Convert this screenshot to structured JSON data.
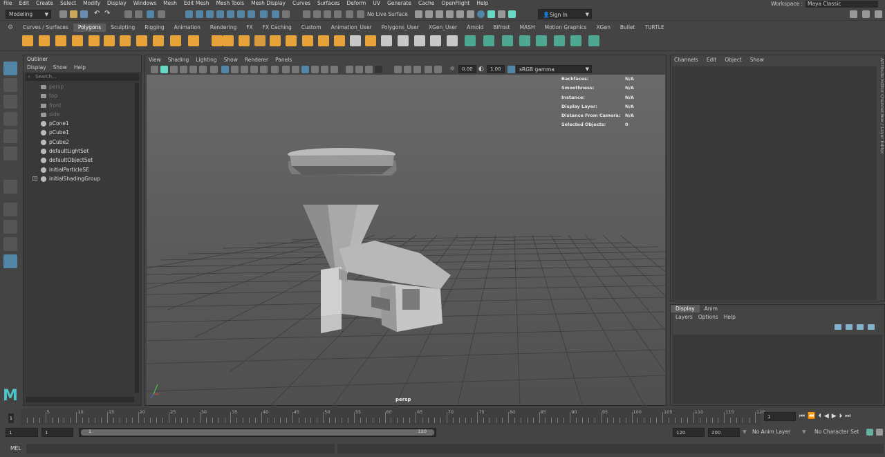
{
  "menus": [
    "File",
    "Edit",
    "Create",
    "Select",
    "Modify",
    "Display",
    "Windows",
    "Mesh",
    "Edit Mesh",
    "Mesh Tools",
    "Mesh Display",
    "Curves",
    "Surfaces",
    "Deform",
    "UV",
    "Generate",
    "Cache",
    "OpenFlight",
    "Help"
  ],
  "workspace": {
    "label": "Workspace :",
    "value": "Maya Classic"
  },
  "status": {
    "mode": "Modeling",
    "live_surface": "No Live Surface",
    "sign_in": "Sign In"
  },
  "shelf_tabs": [
    "Curves / Surfaces",
    "Polygons",
    "Sculpting",
    "Rigging",
    "Animation",
    "Rendering",
    "FX",
    "FX Caching",
    "Custom",
    "Animation_User",
    "Polygons_User",
    "XGen_User",
    "Arnold",
    "Bifrost",
    "MASH",
    "Motion Graphics",
    "XGen",
    "Bullet",
    "TURTLE"
  ],
  "shelf_active": "Polygons",
  "outliner": {
    "title": "Outliner",
    "menus": [
      "Display",
      "Show",
      "Help"
    ],
    "search_placeholder": "Search...",
    "items": [
      {
        "label": "persp",
        "kind": "camera"
      },
      {
        "label": "top",
        "kind": "camera"
      },
      {
        "label": "front",
        "kind": "camera"
      },
      {
        "label": "side",
        "kind": "camera"
      },
      {
        "label": "pCone1",
        "kind": "mesh"
      },
      {
        "label": "pCube1",
        "kind": "mesh"
      },
      {
        "label": "pCube2",
        "kind": "mesh"
      },
      {
        "label": "defaultLightSet",
        "kind": "set"
      },
      {
        "label": "defaultObjectSet",
        "kind": "set"
      },
      {
        "label": "initialParticleSE",
        "kind": "set"
      },
      {
        "label": "initialShadingGroup",
        "kind": "set",
        "expandable": true
      }
    ]
  },
  "viewport": {
    "menus": [
      "View",
      "Shading",
      "Lighting",
      "Show",
      "Renderer",
      "Panels"
    ],
    "exposure": "0.00",
    "gamma": "1.00",
    "color_space": "sRGB gamma",
    "camera": "persp",
    "hud": [
      {
        "label": "Backfaces:",
        "value": "N/A"
      },
      {
        "label": "Smoothness:",
        "value": "N/A"
      },
      {
        "label": "Instance:",
        "value": "N/A"
      },
      {
        "label": "Display Layer:",
        "value": "N/A"
      },
      {
        "label": "Distance From Camera:",
        "value": "N/A"
      },
      {
        "label": "Selected Objects:",
        "value": "0"
      }
    ]
  },
  "channels": {
    "menus": [
      "Channels",
      "Edit",
      "Object",
      "Show"
    ],
    "side_tabs": "Attribute Editor   Channel Box / Layer Editor"
  },
  "layers": {
    "tabs": [
      "Display",
      "Anim"
    ],
    "menus": [
      "Layers",
      "Options",
      "Help"
    ]
  },
  "timeline": {
    "ticks": [
      "1",
      "5",
      "10",
      "15",
      "20",
      "25",
      "30",
      "35",
      "40",
      "45",
      "50",
      "55",
      "60",
      "65",
      "70",
      "75",
      "80",
      "85",
      "90",
      "95",
      "100",
      "105",
      "110",
      "115",
      "120"
    ],
    "current_frame": "1",
    "current_frame_box": "1"
  },
  "range": {
    "start": "1",
    "playback_start": "1",
    "slider_start": "1",
    "slider_end": "120",
    "playback_end": "120",
    "end": "200",
    "anim_layer": "No Anim Layer",
    "character_set": "No Character Set"
  },
  "cmdline": {
    "label": "MEL"
  },
  "colors": {
    "accent": "#5285a6",
    "shelf_green": "#4ea790",
    "highlight": "#66d9c6"
  }
}
